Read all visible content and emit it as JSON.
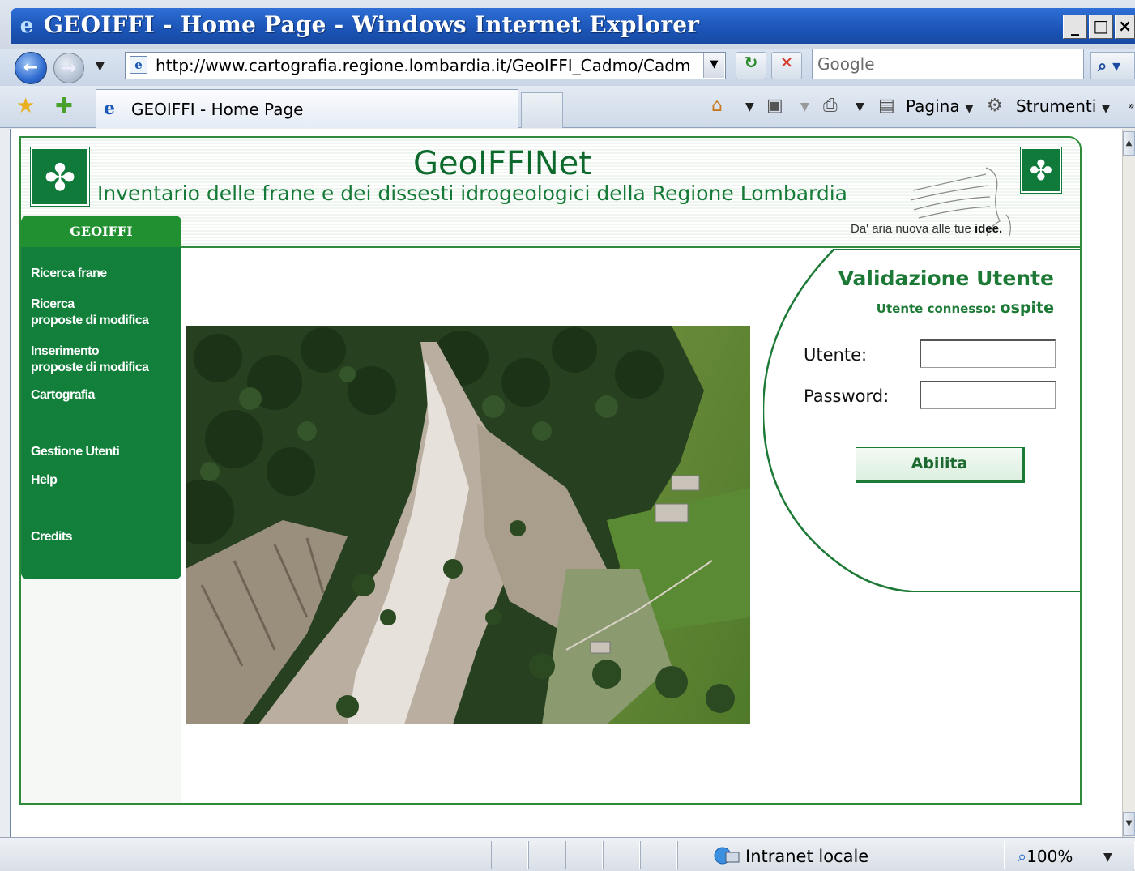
{
  "window": {
    "title": "GEOIFFI - Home Page - Windows Internet Explorer",
    "min_glyph": "_",
    "max_glyph": "□",
    "close_glyph": "×"
  },
  "address_bar": {
    "url": "http://www.cartografia.regione.lombardia.it/GeoIFFI_Cadmo/Cadm",
    "search_placeholder": "Google"
  },
  "tab": {
    "label": "GEOIFFI - Home Page"
  },
  "command_bar": {
    "page_label": "Pagina",
    "tools_label": "Strumenti"
  },
  "site": {
    "title": "GeoIFFINet",
    "subtitle": "Inventario delle frane e dei dissesti idrogeologici della Regione Lombardia",
    "slogan_text": "Da' aria nuova alle tue ",
    "slogan_bold": "idee.",
    "nav_tab": "GEOIFFI",
    "nav_items": [
      {
        "line1": "Ricerca frane",
        "line2": ""
      },
      {
        "line1": "Ricerca",
        "line2": "proposte di modifica"
      },
      {
        "line1": "Inserimento",
        "line2": "proposte di modifica"
      },
      {
        "line1": "Cartografia",
        "line2": ""
      },
      {
        "line1": "Gestione Utenti",
        "line2": ""
      },
      {
        "line1": "Help",
        "line2": ""
      },
      {
        "line1": "Credits",
        "line2": ""
      }
    ]
  },
  "login": {
    "title": "Validazione Utente",
    "connected_label": "Utente connesso:",
    "connected_user": "ospite",
    "user_label": "Utente:",
    "user_value": "",
    "password_label": "Password:",
    "password_value": "",
    "submit_label": "Abilita"
  },
  "status_bar": {
    "zone": "Intranet locale",
    "zoom": "100%"
  },
  "colors": {
    "brand_green": "#12803a",
    "ie_blue": "#1c56b8"
  }
}
